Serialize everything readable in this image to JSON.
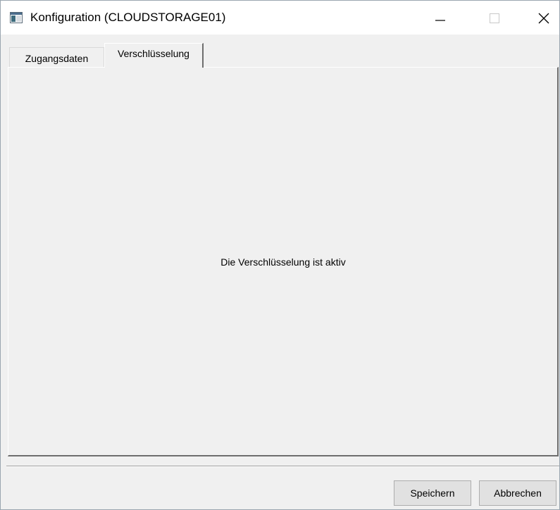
{
  "window": {
    "title": "Konfiguration (CLOUDSTORAGE01)",
    "app_icon": "window-app-icon",
    "controls": {
      "minimize_icon": "minimize-icon",
      "maximize_icon": "maximize-icon",
      "close_icon": "close-icon"
    }
  },
  "tabs": [
    {
      "label": "Zugangsdaten",
      "active": false
    },
    {
      "label": "Verschlüsselung",
      "active": true
    }
  ],
  "panel": {
    "message": "Die Verschlüsselung ist aktiv"
  },
  "footer": {
    "save_label": "Speichern",
    "cancel_label": "Abbrechen"
  }
}
